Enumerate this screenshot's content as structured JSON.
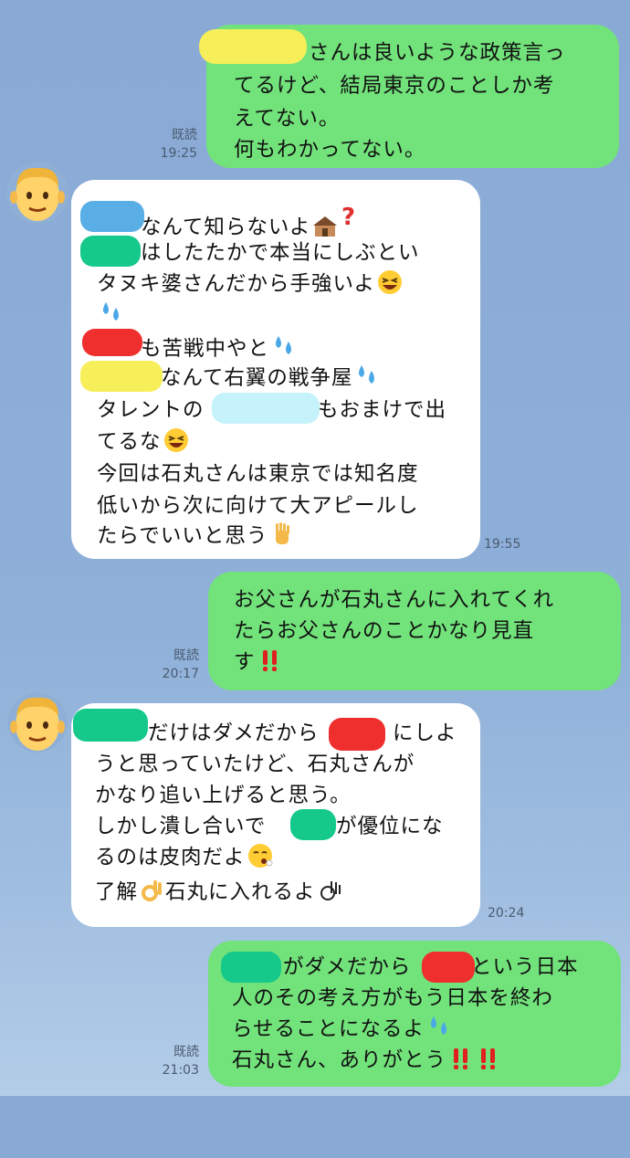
{
  "messages": [
    {
      "direction": "out",
      "lines": [
        "さんは良いような政策言っ",
        "てるけど、結局東京のことしか考",
        "えてない。",
        "何もわかってない。"
      ],
      "read_label": "既読",
      "time": "19:25"
    },
    {
      "direction": "in",
      "lines": [
        "なんて知らないよ",
        "はしたたかで本当にしぶとい",
        "タヌキ婆さんだから手強いよ",
        "",
        "も苦戦中やと",
        "なんて右翼の戦争屋",
        "タレントの",
        "もおまけで出",
        "てるな",
        "今回は石丸さんは東京では知名度",
        "低いから次に向けて大アピールし",
        "たらでいいと思う"
      ],
      "time": "19:55"
    },
    {
      "direction": "out",
      "lines": [
        "お父さんが石丸さんに入れてくれ",
        "たらお父さんのことかなり見直",
        "す"
      ],
      "read_label": "既読",
      "time": "20:17"
    },
    {
      "direction": "in",
      "lines": [
        "だけはダメだから",
        "にしよ",
        "うと思っていたけど、石丸さんが",
        "かなり追い上げると思う。",
        "しかし潰し合いで",
        "が優位にな",
        "るのは皮肉だよ",
        "了解",
        "石丸に入れるよ"
      ],
      "time": "20:24"
    },
    {
      "direction": "out",
      "lines": [
        "がダメだから",
        "という日本",
        "人のその考え方がもう日本を終わ",
        "らせることになるよ",
        "石丸さん、ありがとう"
      ],
      "read_label": "既読",
      "time": "21:03"
    }
  ],
  "icons": {
    "avatar": "man-face-emoji",
    "sweat": "sweat-droplets-emoji",
    "laugh": "grinning-squinting-face-emoji",
    "double_exclaim": "double-exclamation-emoji",
    "ok": "ok-hand-emoji",
    "raised_hand": "raised-hand-emoji",
    "hut": "hut-emoji",
    "question": "red-question-mark-emoji",
    "sweat_face": "face-exhaling-emoji"
  },
  "colors": {
    "outgoing_bubble": "#72e27b",
    "incoming_bubble": "#ffffff",
    "background": "#8dafd8",
    "redaction_yellow": "#f7ef5a",
    "redaction_blue": "#5aaee6",
    "redaction_green": "#14c98a",
    "redaction_red": "#ef2e2e",
    "redaction_cyan": "#c6f3fb"
  }
}
